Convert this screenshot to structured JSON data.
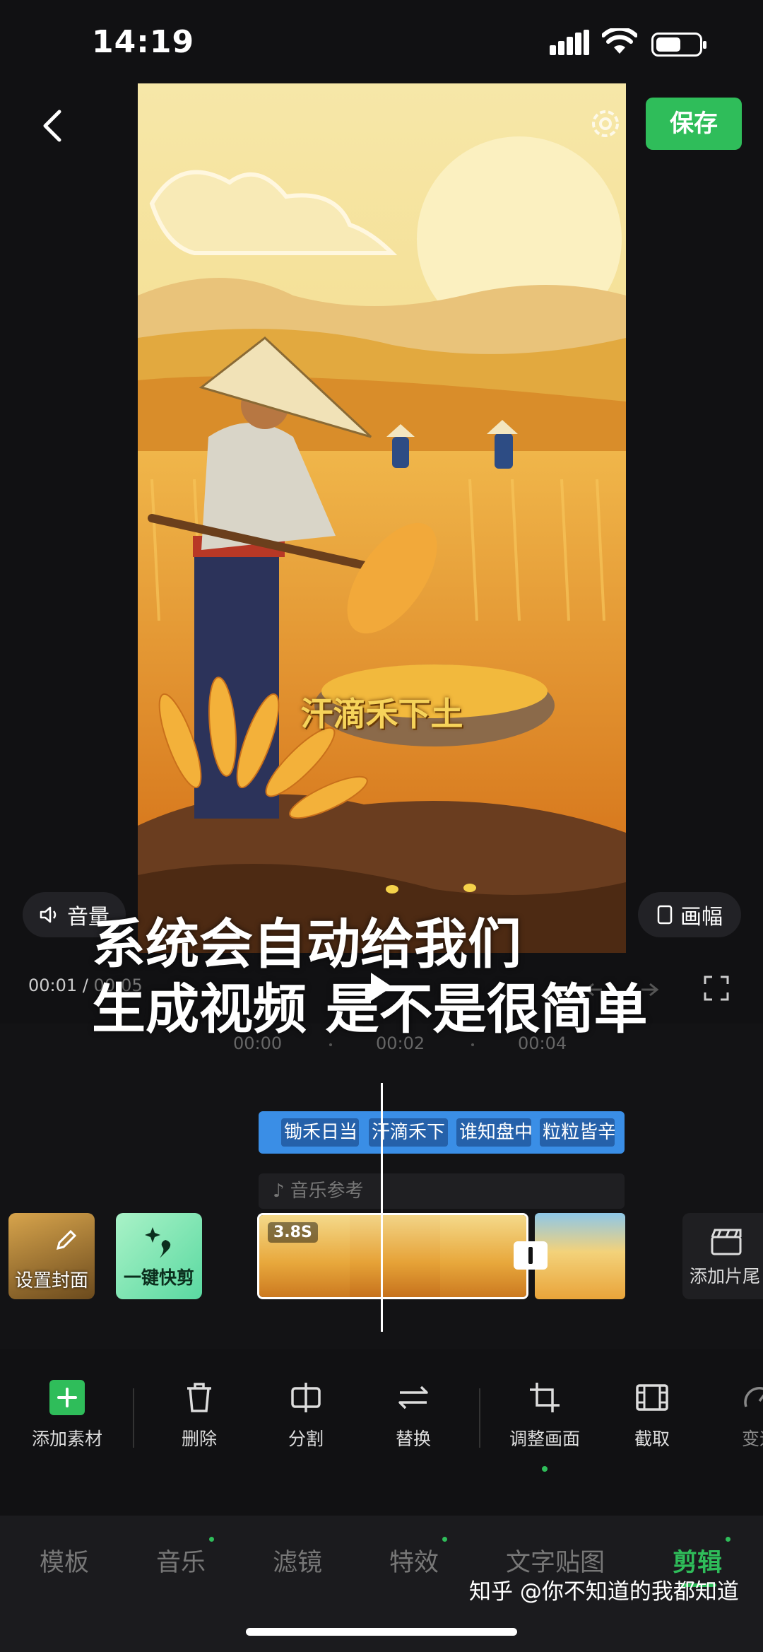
{
  "status_bar": {
    "time": "14:19"
  },
  "header": {
    "save_label": "保存"
  },
  "preview": {
    "subtitle": "汗滴禾下土",
    "volume_label": "音量",
    "ratio_label": "画幅",
    "current_time": "00:01",
    "total_time": "00:05",
    "time_separator": "/"
  },
  "overlay_caption": {
    "line1": "系统会自动给我们",
    "line2": "生成视频 是不是很简单"
  },
  "timeline": {
    "ruler": [
      "00:00",
      "00:02",
      "00:04"
    ],
    "subtitle_chips": [
      "锄禾日当",
      "汗滴禾下",
      "谁知盘中",
      "粒粒皆辛"
    ],
    "music_label": "音乐参考",
    "cover_label": "设置封面",
    "quick_edit_label": "一键快剪",
    "clip_duration": "3.8S",
    "add_ending_label": "添加片尾"
  },
  "toolbar": {
    "items": [
      "添加素材",
      "删除",
      "分割",
      "替换",
      "调整画面",
      "截取",
      "变速"
    ]
  },
  "tabs": {
    "items": [
      "模板",
      "音乐",
      "滤镜",
      "特效",
      "文字贴图",
      "剪辑"
    ],
    "active": "剪辑"
  },
  "watermark": "知乎 @你不知道的我都知道",
  "colors": {
    "accent": "#2fbd5a",
    "subtitle_track": "#3a8ee6",
    "background": "#111113"
  }
}
